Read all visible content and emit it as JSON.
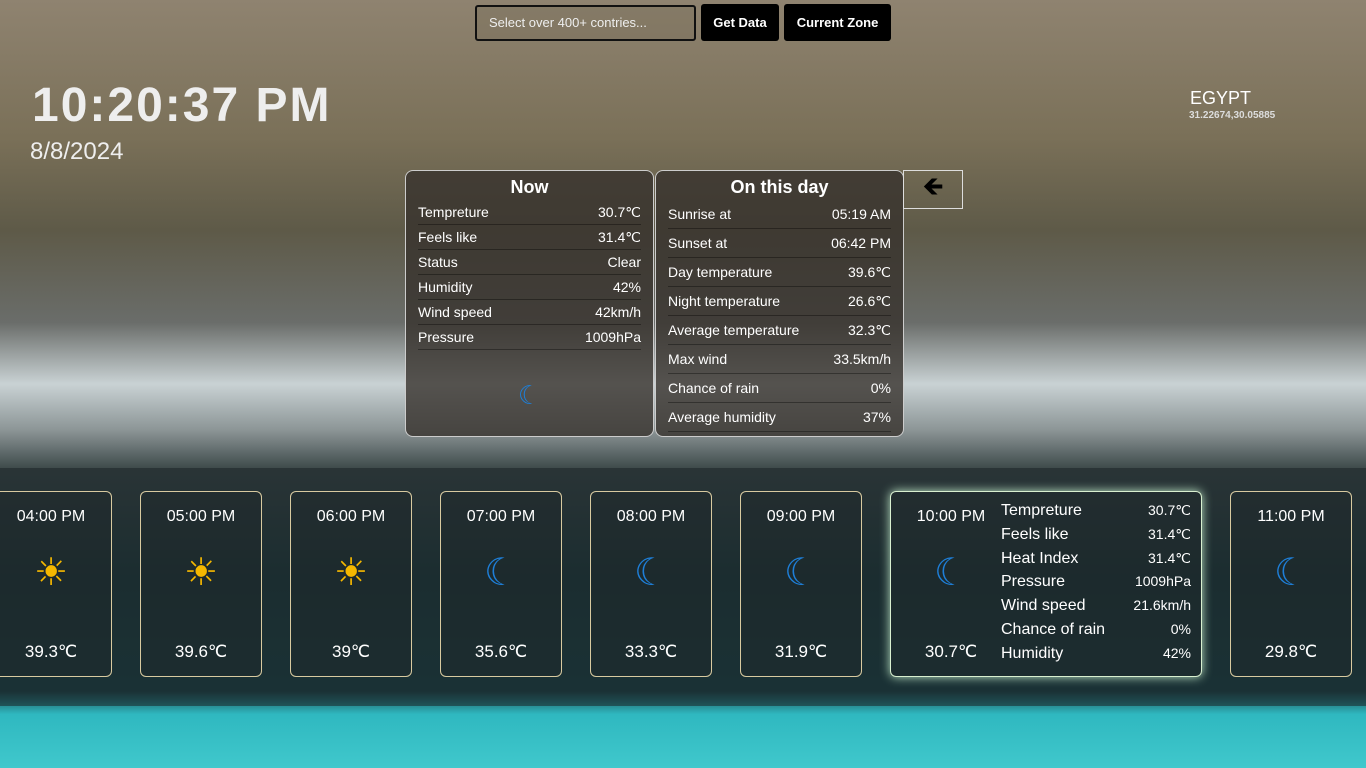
{
  "search": {
    "placeholder": "Select over 400+ contries..."
  },
  "buttons": {
    "get_data": "Get Data",
    "current_zone": "Current Zone"
  },
  "clock": {
    "time": "10:20:37 PM",
    "date": "8/8/2024"
  },
  "location": {
    "country": "EGYPT",
    "coords": "31.22674,30.05885"
  },
  "now": {
    "title": "Now",
    "rows": [
      [
        "Tempreture",
        "30.7℃"
      ],
      [
        "Feels like",
        "31.4℃"
      ],
      [
        "Status",
        "Clear"
      ],
      [
        "Humidity",
        "42%"
      ],
      [
        "Wind speed",
        "42km/h"
      ],
      [
        "Pressure",
        "1009hPa"
      ]
    ],
    "icon": "moon-icon"
  },
  "day": {
    "title": "On this day",
    "rows": [
      [
        "Sunrise at",
        "05:19 AM"
      ],
      [
        "Sunset at",
        "06:42 PM"
      ],
      [
        "Day temperature",
        "39.6℃"
      ],
      [
        "Night temperature",
        "26.6℃"
      ],
      [
        "Average temperature",
        "32.3℃"
      ],
      [
        "Max wind",
        "33.5km/h"
      ],
      [
        "Chance of rain",
        "0%"
      ],
      [
        "Average humidity",
        "37%"
      ]
    ]
  },
  "arrow": "🡸",
  "hours": [
    {
      "time": "04:00 PM",
      "temp": "39.3℃",
      "icon": "sun"
    },
    {
      "time": "05:00 PM",
      "temp": "39.6℃",
      "icon": "sun"
    },
    {
      "time": "06:00 PM",
      "temp": "39℃",
      "icon": "sun"
    },
    {
      "time": "07:00 PM",
      "temp": "35.6℃",
      "icon": "moon"
    },
    {
      "time": "08:00 PM",
      "temp": "33.3℃",
      "icon": "moon"
    },
    {
      "time": "09:00 PM",
      "temp": "31.9℃",
      "icon": "moon"
    },
    {
      "time": "10:00 PM",
      "temp": "30.7℃",
      "icon": "moon",
      "details": [
        [
          "Tempreture",
          "30.7℃"
        ],
        [
          "Feels like",
          "31.4℃"
        ],
        [
          "Heat Index",
          "31.4℃"
        ],
        [
          "Pressure",
          "1009hPa"
        ],
        [
          "Wind speed",
          "21.6km/h"
        ],
        [
          "Chance of rain",
          "0%"
        ],
        [
          "Humidity",
          "42%"
        ]
      ]
    },
    {
      "time": "11:00 PM",
      "temp": "29.8℃",
      "icon": "moon"
    }
  ]
}
